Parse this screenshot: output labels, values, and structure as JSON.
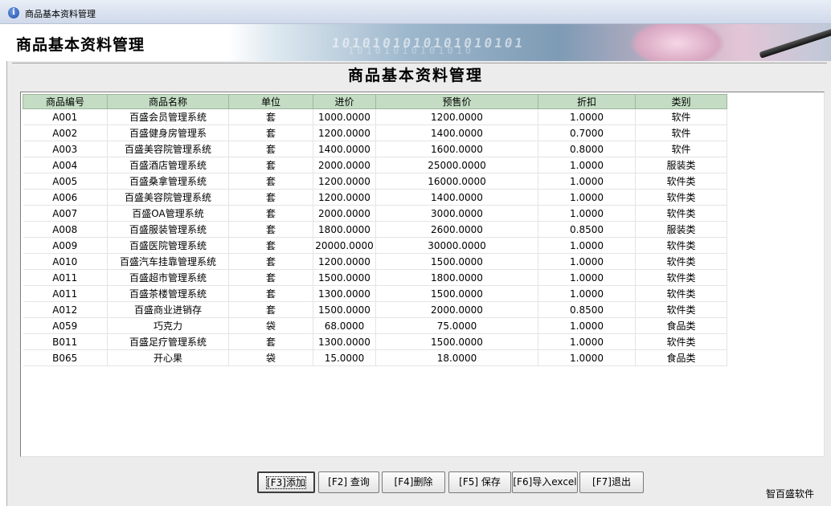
{
  "window": {
    "title": "商品基本资料管理"
  },
  "header": {
    "title": "商品基本资料管理",
    "banner_digits": "1010101010101010101",
    "banner_digits2": "10101010101010"
  },
  "page": {
    "title": "商品基本资料管理"
  },
  "table": {
    "columns": [
      "商品编号",
      "商品名称",
      "单位",
      "进价",
      "预售价",
      "折扣",
      "类别"
    ],
    "rows": [
      [
        "A001",
        "百盛会员管理系统",
        "套",
        "1000.0000",
        "1200.0000",
        "1.0000",
        "软件"
      ],
      [
        "A002",
        "百盛健身房管理系",
        "套",
        "1200.0000",
        "1400.0000",
        "0.7000",
        "软件"
      ],
      [
        "A003",
        "百盛美容院管理系统",
        "套",
        "1400.0000",
        "1600.0000",
        "0.8000",
        "软件"
      ],
      [
        "A004",
        "百盛酒店管理系统",
        "套",
        "2000.0000",
        "25000.0000",
        "1.0000",
        "服装类"
      ],
      [
        "A005",
        "百盛桑拿管理系统",
        "套",
        "1200.0000",
        "16000.0000",
        "1.0000",
        "软件类"
      ],
      [
        "A006",
        "百盛美容院管理系统",
        "套",
        "1200.0000",
        "1400.0000",
        "1.0000",
        "软件类"
      ],
      [
        "A007",
        "百盛OA管理系统",
        "套",
        "2000.0000",
        "3000.0000",
        "1.0000",
        "软件类"
      ],
      [
        "A008",
        "百盛服装管理系统",
        "套",
        "1800.0000",
        "2600.0000",
        "0.8500",
        "服装类"
      ],
      [
        "A009",
        "百盛医院管理系统",
        "套",
        "20000.0000",
        "30000.0000",
        "1.0000",
        "软件类"
      ],
      [
        "A010",
        "百盛汽车挂靠管理系统",
        "套",
        "1200.0000",
        "1500.0000",
        "1.0000",
        "软件类"
      ],
      [
        "A011",
        "百盛超市管理系统",
        "套",
        "1500.0000",
        "1800.0000",
        "1.0000",
        "软件类"
      ],
      [
        "A011",
        "百盛茶楼管理系统",
        "套",
        "1300.0000",
        "1500.0000",
        "1.0000",
        "软件类"
      ],
      [
        "A012",
        "百盛商业进销存",
        "套",
        "1500.0000",
        "2000.0000",
        "0.8500",
        "软件类"
      ],
      [
        "A059",
        "巧克力",
        "袋",
        "68.0000",
        "75.0000",
        "1.0000",
        "食品类"
      ],
      [
        "B011",
        "百盛足疗管理系统",
        "套",
        "1300.0000",
        "1500.0000",
        "1.0000",
        "软件类"
      ],
      [
        "B065",
        "开心果",
        "袋",
        "15.0000",
        "18.0000",
        "1.0000",
        "食品类"
      ]
    ]
  },
  "buttons": {
    "add": "[F3]添加",
    "query": "[F2] 查询",
    "delete": "[F4]删除",
    "save": "[F5] 保存",
    "import": "[F6]导入excel",
    "exit": "[F7]退出"
  },
  "footer": {
    "brand": "智百盛软件"
  },
  "colors": {
    "header_row": "#c3dcc3",
    "titlebar": "#d6e0ef"
  },
  "icons": {
    "window_icon": "info-icon"
  }
}
